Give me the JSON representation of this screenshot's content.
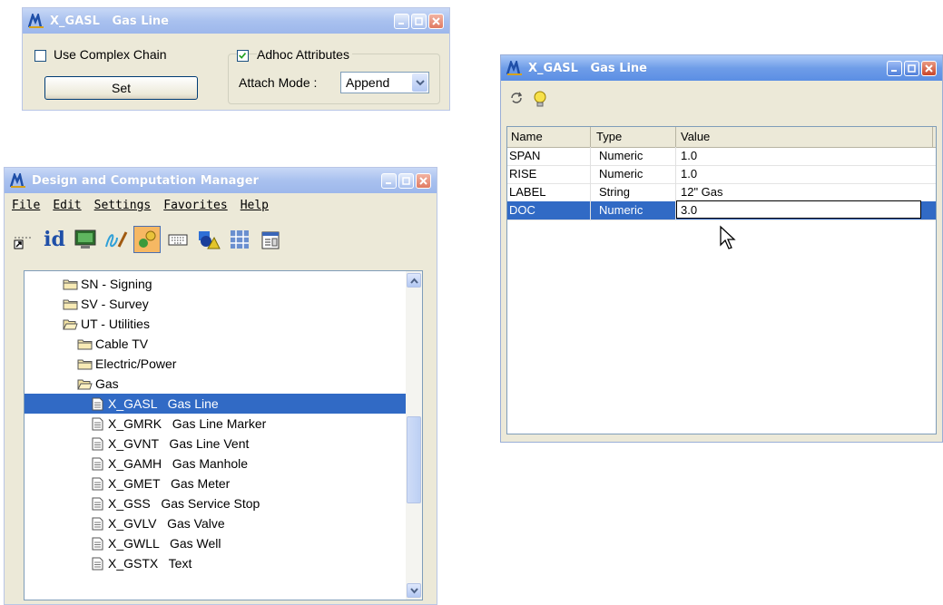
{
  "window_attrs": {
    "title_code": "X_GASL",
    "title_name": "Gas Line",
    "use_complex_chain_label": "Use Complex Chain",
    "use_complex_chain_checked": false,
    "set_button_label": "Set",
    "adhoc_attributes_label": "Adhoc Attributes",
    "adhoc_attributes_checked": true,
    "attach_mode_label": "Attach Mode :",
    "attach_mode_value": "Append"
  },
  "window_manager": {
    "title": "Design and Computation Manager",
    "menu": [
      {
        "label": "File",
        "accel": "F"
      },
      {
        "label": "Edit",
        "accel": "E"
      },
      {
        "label": "Settings",
        "accel": "S"
      },
      {
        "label": "Favorites",
        "accel": "a"
      },
      {
        "label": "Help",
        "accel": "H"
      }
    ],
    "toolbar": [
      "place-point-icon",
      "id-icon",
      "monitor-icon",
      "curve-pen-icon",
      "computation-icon",
      "keyboard-icon",
      "shapes-icon",
      "tabular-icon",
      "properties-icon"
    ],
    "toolbar_id_text": "id",
    "tree": [
      {
        "label": "SN - Signing",
        "type": "folder",
        "level": 0
      },
      {
        "label": "SV - Survey",
        "type": "folder",
        "level": 0
      },
      {
        "label": "UT - Utilities",
        "type": "folder-open",
        "level": 0
      },
      {
        "label": "Cable TV",
        "type": "folder",
        "level": 1
      },
      {
        "label": "Electric/Power",
        "type": "folder",
        "level": 1
      },
      {
        "label": "Gas",
        "type": "folder-open",
        "level": 1
      },
      {
        "label": "X_GASL   Gas Line",
        "type": "item",
        "level": 2,
        "selected": true
      },
      {
        "label": "X_GMRK   Gas Line Marker",
        "type": "item",
        "level": 2
      },
      {
        "label": "X_GVNT   Gas Line Vent",
        "type": "item",
        "level": 2
      },
      {
        "label": "X_GAMH   Gas Manhole",
        "type": "item",
        "level": 2
      },
      {
        "label": "X_GMET   Gas Meter",
        "type": "item",
        "level": 2
      },
      {
        "label": "X_GSS   Gas Service Stop",
        "type": "item",
        "level": 2
      },
      {
        "label": "X_GVLV   Gas Valve",
        "type": "item",
        "level": 2
      },
      {
        "label": "X_GWLL   Gas Well",
        "type": "item",
        "level": 2
      },
      {
        "label": "X_GSTX   Text",
        "type": "item",
        "level": 2
      }
    ]
  },
  "window_grid": {
    "title_code": "X_GASL",
    "title_name": "Gas Line",
    "toolbar": [
      "refresh-icon",
      "hint-icon"
    ],
    "columns": [
      "Name",
      "Type",
      "Value"
    ],
    "rows": [
      {
        "name": "SPAN",
        "type": "Numeric",
        "value": "1.0"
      },
      {
        "name": "RISE",
        "type": "Numeric",
        "value": "1.0"
      },
      {
        "name": "LABEL",
        "type": "String",
        "value": "12\" Gas"
      },
      {
        "name": "DOC",
        "type": "Numeric",
        "value": "3.0",
        "selected": true,
        "editing": true
      }
    ]
  },
  "colors": {
    "selection": "#316ac5",
    "window_face": "#ece9d8",
    "titlebar_active": "#5b8ee4",
    "titlebar_inactive": "#a9c1ef"
  }
}
